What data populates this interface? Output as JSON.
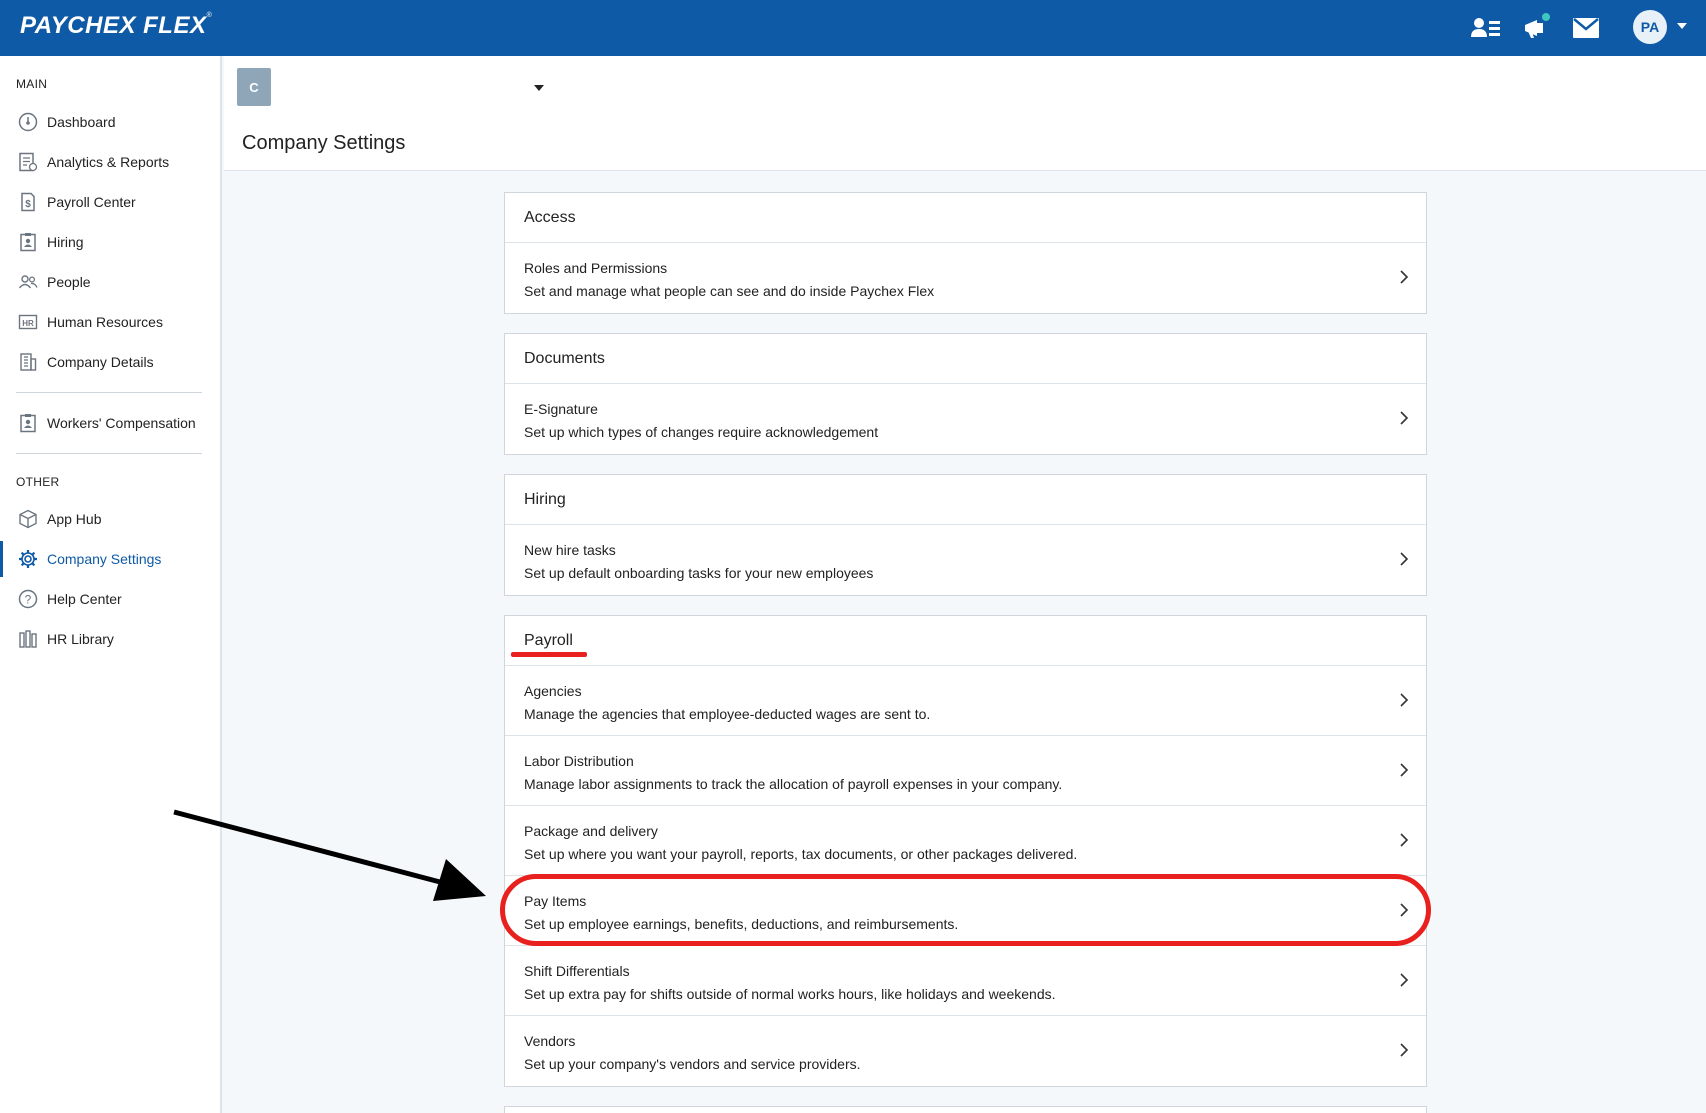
{
  "app": {
    "logo": "PAYCHEX FLEX",
    "logo_mark": "®",
    "user_initials": "PA"
  },
  "topbar": {
    "icons": [
      "people-list-icon",
      "megaphone-icon",
      "mail-icon"
    ]
  },
  "sidebar": {
    "main_label": "MAIN",
    "main_items": [
      {
        "label": "Dashboard",
        "icon": "dashboard-icon"
      },
      {
        "label": "Analytics & Reports",
        "icon": "reports-icon"
      },
      {
        "label": "Payroll Center",
        "icon": "payroll-icon"
      },
      {
        "label": "Hiring",
        "icon": "hiring-icon"
      },
      {
        "label": "People",
        "icon": "people-icon"
      },
      {
        "label": "Human Resources",
        "icon": "hr-icon"
      },
      {
        "label": "Company Details",
        "icon": "building-icon"
      }
    ],
    "extra_item": {
      "label": "Workers' Compensation",
      "icon": "clipboard-icon"
    },
    "other_label": "OTHER",
    "other_items": [
      {
        "label": "App Hub",
        "icon": "cube-icon"
      },
      {
        "label": "Company Settings",
        "icon": "gear-icon",
        "active": true
      },
      {
        "label": "Help Center",
        "icon": "help-icon"
      },
      {
        "label": "HR Library",
        "icon": "library-icon"
      }
    ]
  },
  "header": {
    "company_initial": "C",
    "title": "Company Settings"
  },
  "sections": [
    {
      "title": "Access",
      "rows": [
        {
          "title": "Roles and Permissions",
          "desc": "Set and manage what people can see and do inside Paychex Flex"
        }
      ]
    },
    {
      "title": "Documents",
      "rows": [
        {
          "title": "E-Signature",
          "desc": "Set up which types of changes require acknowledgement"
        }
      ]
    },
    {
      "title": "Hiring",
      "rows": [
        {
          "title": "New hire tasks",
          "desc": "Set up default onboarding tasks for your new employees"
        }
      ]
    },
    {
      "title": "Payroll",
      "rows": [
        {
          "title": "Agencies",
          "desc": "Manage the agencies that employee-deducted wages are sent to."
        },
        {
          "title": "Labor Distribution",
          "desc": "Manage labor assignments to track the allocation of payroll expenses in your company."
        },
        {
          "title": "Package and delivery",
          "desc": "Set up where you want your payroll, reports, tax documents, or other packages delivered."
        },
        {
          "title": "Pay Items",
          "desc": "Set up employee earnings, benefits, deductions, and reimbursements."
        },
        {
          "title": "Shift Differentials",
          "desc": "Set up extra pay for shifts outside of normal works hours, like holidays and weekends."
        },
        {
          "title": "Vendors",
          "desc": "Set up your company's vendors and service providers."
        }
      ]
    }
  ],
  "annotations": {
    "highlight_color": "#e8201e",
    "arrow_color": "#000000"
  }
}
